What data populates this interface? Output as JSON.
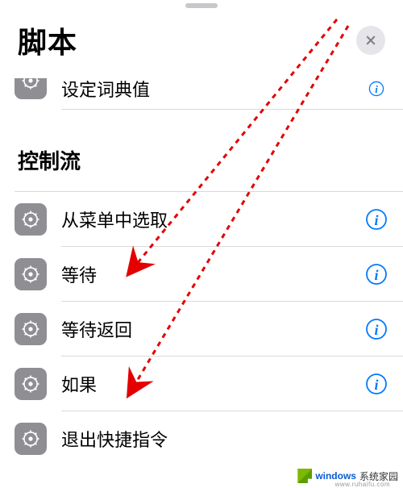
{
  "header": {
    "title": "脚本"
  },
  "partial_row": {
    "label": "设定词典值"
  },
  "section": {
    "title": "控制流"
  },
  "items": [
    {
      "label": "从菜单中选取"
    },
    {
      "label": "等待"
    },
    {
      "label": "等待返回"
    },
    {
      "label": "如果"
    },
    {
      "label": "退出快捷指令"
    }
  ],
  "watermark": {
    "brand1": "windows",
    "brand2": "系统家园",
    "sub": "www.ruhaifu.com"
  }
}
